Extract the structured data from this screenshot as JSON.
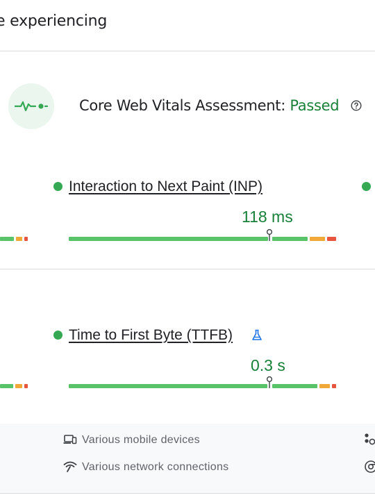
{
  "header": {
    "title": "e experiencing"
  },
  "assessment": {
    "label": "Core Web Vitals Assessment:",
    "status": "Passed",
    "status_color": "#188038",
    "icon": "heartbeat-icon",
    "help_icon": "help-circle-icon"
  },
  "metrics": [
    {
      "name": "Interaction to Next Paint (INP)",
      "value": "118 ms",
      "status_color": "#34a853",
      "distribution": {
        "good": 0.83,
        "needs_improvement": 0.08,
        "poor": 0.05
      },
      "marker_position": 0.8
    },
    {
      "name": "Time to First Byte (TTFB)",
      "value": "0.3 s",
      "status_color": "#34a853",
      "badge_icon": "flask-icon",
      "distribution": {
        "good": 0.9,
        "needs_improvement": 0.05,
        "poor": 0.02
      },
      "marker_position": 0.8
    }
  ],
  "footer": {
    "device": {
      "icon": "devices-icon",
      "label": "Various mobile devices"
    },
    "network": {
      "icon": "signal-icon",
      "label": "Various network connections"
    }
  },
  "colors": {
    "good": "#59c36a",
    "needs_improvement": "#f0a938",
    "poor": "#e8553e"
  }
}
